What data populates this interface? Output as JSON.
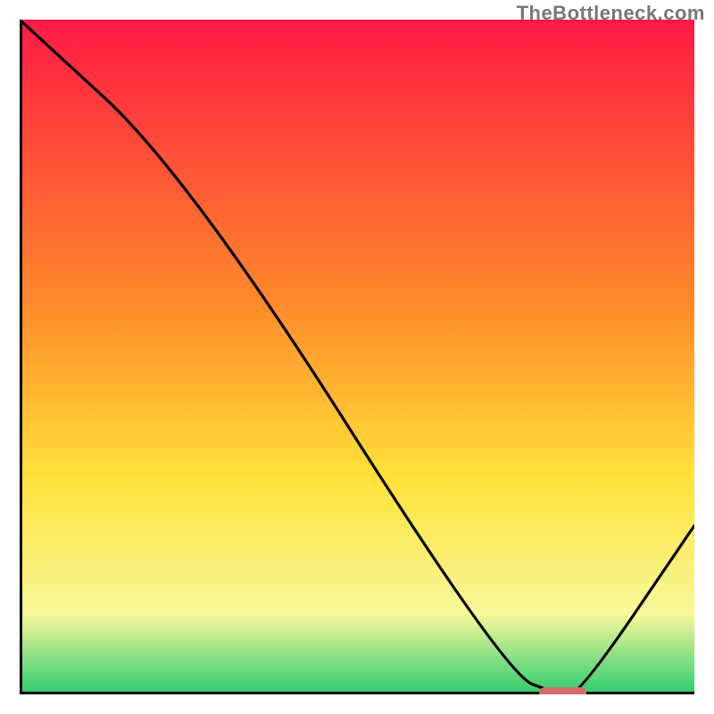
{
  "watermark": "TheBottleneck.com",
  "colors": {
    "axis": "#000000",
    "curve": "#000000",
    "marker_fill": "#d86a6a",
    "marker_stroke": "#d86a6a",
    "grad_top": "#ff1a44",
    "grad_mid1": "#ff8a2a",
    "grad_mid2": "#ffe23a",
    "grad_mid3": "#f8f89a",
    "grad_bottom": "#2ecc71"
  },
  "chart_data": {
    "type": "line",
    "title": "",
    "xlabel": "",
    "ylabel": "",
    "xlim": [
      0,
      100
    ],
    "ylim": [
      0,
      100
    ],
    "x": [
      0,
      25,
      72,
      80,
      83,
      100
    ],
    "values": [
      100,
      77,
      3,
      0,
      0,
      25
    ],
    "marker": {
      "x_start": 77,
      "x_end": 84,
      "y": 0
    },
    "annotations": []
  },
  "plot": {
    "viewbox_w": 756,
    "viewbox_h": 756
  }
}
